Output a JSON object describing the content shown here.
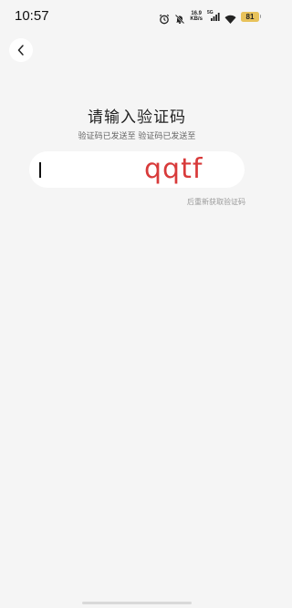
{
  "status_bar": {
    "time": "10:57",
    "net_speed_value": "16.9",
    "net_speed_unit": "KB/s",
    "network_type": "5G",
    "battery": "81",
    "icons": [
      "alarm-icon",
      "mute-icon",
      "signal-icon",
      "wifi-icon",
      "battery-icon"
    ]
  },
  "header": {
    "back_icon": "chevron-left-icon"
  },
  "main": {
    "title": "请输入验证码",
    "subtitle": "验证码已发送至  验证码已发送至",
    "code_value": "",
    "captcha_overlay": "qqtf",
    "resend_label": "后重新获取验证码"
  },
  "colors": {
    "background": "#f5f5f5",
    "input_bg": "#ffffff",
    "captcha": "#d83a3a",
    "battery": "#e8c25a",
    "muted_text": "#9a9a9a"
  }
}
